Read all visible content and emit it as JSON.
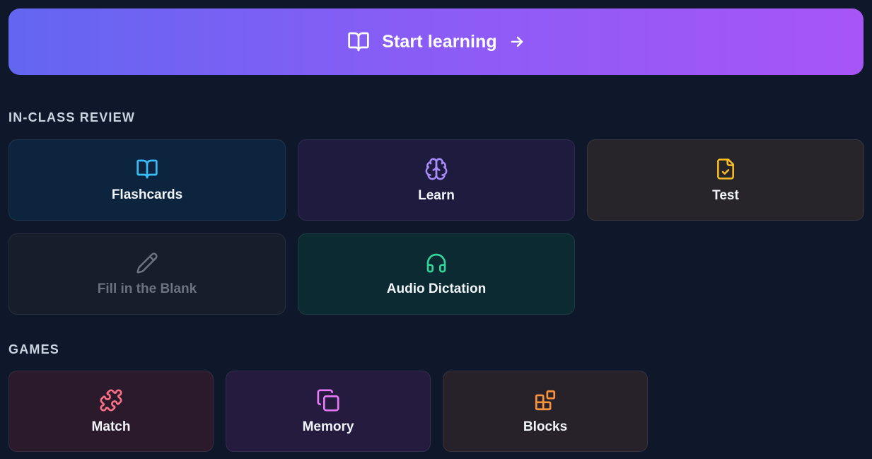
{
  "start": {
    "label": "Start learning",
    "icon": "book-open-icon",
    "arrow": "arrow-right-icon"
  },
  "in_class_review": {
    "title": "IN-CLASS REVIEW",
    "items": [
      {
        "label": "Flashcards",
        "icon": "book-open-icon",
        "color": "#38bdf8"
      },
      {
        "label": "Learn",
        "icon": "brain-icon",
        "color": "#a78bfa"
      },
      {
        "label": "Test",
        "icon": "file-check-icon",
        "color": "#fbbf24"
      },
      {
        "label": "Fill in the Blank",
        "icon": "pencil-icon",
        "color": "#6b7280",
        "disabled": true
      },
      {
        "label": "Audio Dictation",
        "icon": "headphones-icon",
        "color": "#34d399"
      }
    ]
  },
  "games": {
    "title": "GAMES",
    "items": [
      {
        "label": "Match",
        "icon": "puzzle-icon",
        "color": "#fb7185"
      },
      {
        "label": "Memory",
        "icon": "copy-icon",
        "color": "#e879f9"
      },
      {
        "label": "Blocks",
        "icon": "blocks-icon",
        "color": "#fb923c"
      }
    ]
  }
}
